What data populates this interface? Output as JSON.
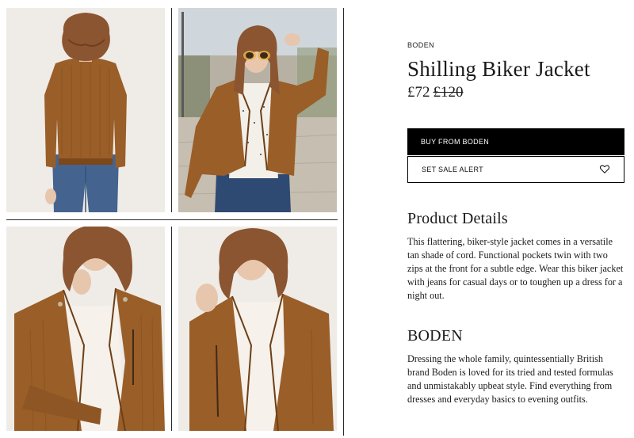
{
  "product": {
    "brand": "BODEN",
    "title": "Shilling Biker Jacket",
    "price_sale": "£72",
    "price_original": "£120"
  },
  "actions": {
    "buy_label": "BUY FROM BODEN",
    "alert_label": "SET SALE ALERT",
    "alert_icon": "heart-icon"
  },
  "details": {
    "heading": "Product Details",
    "text": "This flattering, biker-style jacket comes in a versatile tan shade of cord. Functional pockets twin with two zips at the front for a subtle edge. Wear this biker jacket with jeans for casual days or to toughen up a dress for a night out."
  },
  "brand_info": {
    "heading": "BODEN",
    "text": "Dressing the whole family, quintessentially British brand Boden is loved for its tried and tested formulas and unmistakably upbeat style. Find everything from dresses and everyday basics to evening outfits."
  },
  "colors": {
    "jacket": "#9a5e28",
    "jacket_dark": "#6e3f17",
    "hair": "#8a5530",
    "denim": "#3f5f8a",
    "skin": "#e7c6ae",
    "button_bg": "#000000"
  }
}
